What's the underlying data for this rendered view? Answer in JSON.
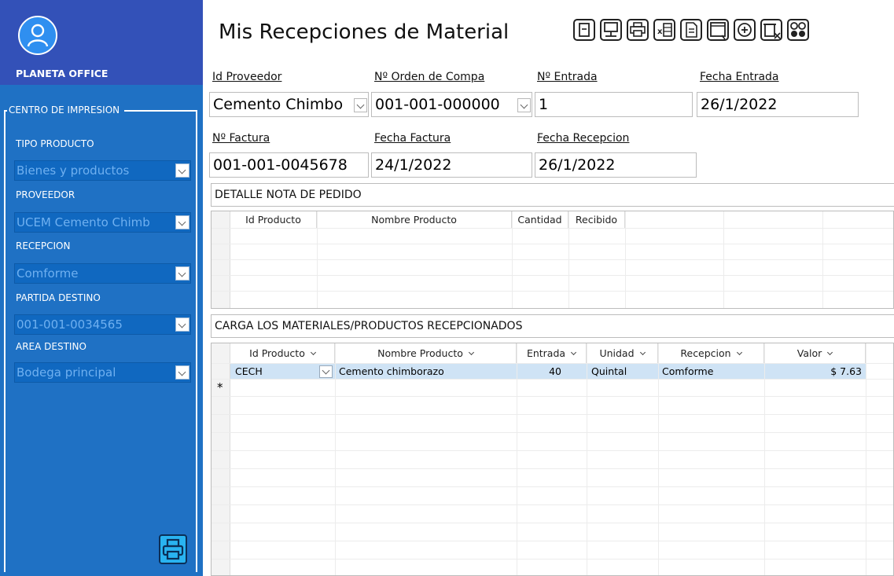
{
  "sidebar": {
    "app_name": "PLANETA OFFICE",
    "group_title": "CENTRO DE IMPRESION",
    "filters": [
      {
        "label": "TIPO PRODUCTO",
        "value": "Bienes y productos"
      },
      {
        "label": "PROVEEDOR",
        "value": "UCEM Cemento Chimb"
      },
      {
        "label": "RECEPCION",
        "value": "Comforme"
      },
      {
        "label": "PARTIDA DESTINO",
        "value": "001-001-0034565"
      },
      {
        "label": "AREA DESTINO",
        "value": "Bodega principal"
      }
    ],
    "print_icon": "printer-icon"
  },
  "header": {
    "title": "Mis Recepciones de Material",
    "toolbar": [
      "form-icon",
      "presentation-icon",
      "printer-icon",
      "excel-icon",
      "document-icon",
      "window-icon",
      "add-circle-icon",
      "delete-icon",
      "options-icon"
    ]
  },
  "form": {
    "id_proveedor": {
      "label": "Id Proveedor",
      "value": "Cemento Chimbo"
    },
    "orden_compra": {
      "label": "Nº Orden de Compa",
      "value": "001-001-000000"
    },
    "entrada": {
      "label": "Nº Entrada",
      "value": "1"
    },
    "fecha_entrada": {
      "label": "Fecha Entrada",
      "value": "26/1/2022"
    },
    "factura": {
      "label": "Nº Factura",
      "value": "001-001-0045678"
    },
    "fecha_factura": {
      "label": "Fecha Factura",
      "value": "24/1/2022"
    },
    "fecha_recepcion": {
      "label": "Fecha Recepcion",
      "value": "26/1/2022"
    }
  },
  "pedido": {
    "title": "DETALLE NOTA DE PEDIDO",
    "columns": [
      "Id Producto",
      "Nombre Producto",
      "Cantidad",
      "Recibido"
    ]
  },
  "carga": {
    "title": "CARGA LOS MATERIALES/PRODUCTOS RECEPCIONADOS",
    "columns": [
      "Id Producto",
      "Nombre Producto",
      "Entrada",
      "Unidad",
      "Recepcion",
      "Valor"
    ],
    "rows": [
      {
        "id": "CECH",
        "nombre": "Cemento chimborazo",
        "entrada": "40",
        "unidad": "Quintal",
        "recepcion": "Comforme",
        "valor": "$ 7.63"
      }
    ],
    "new_row_marker": "*"
  },
  "colors": {
    "sidebar": "#1f71c4",
    "sidebar_header": "#3351b8",
    "selected_row": "#cfe3f5"
  }
}
